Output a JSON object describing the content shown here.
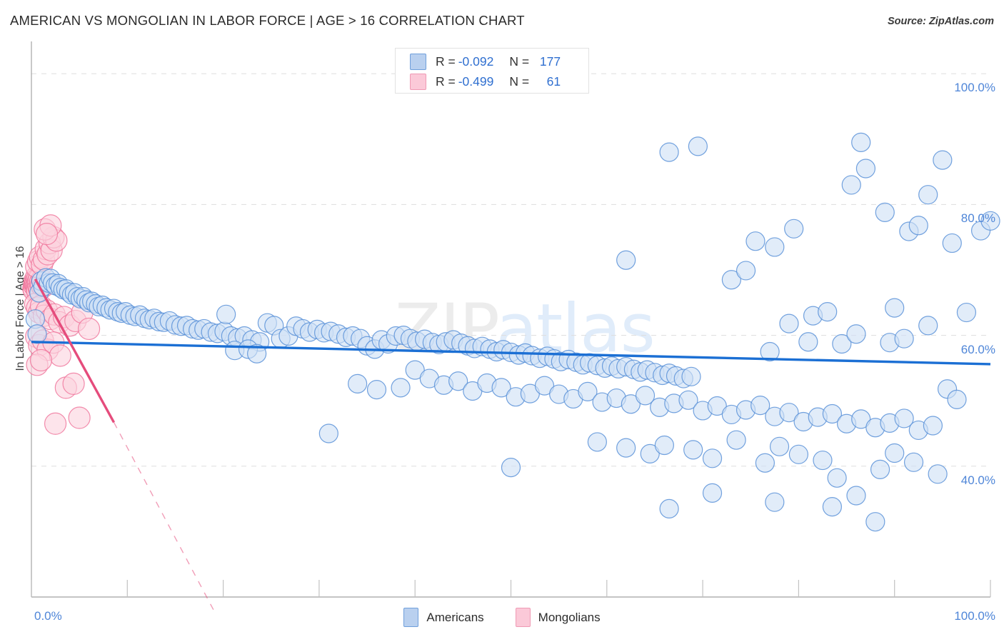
{
  "header": {
    "title": "AMERICAN VS MONGOLIAN IN LABOR FORCE | AGE > 16 CORRELATION CHART",
    "source": "Source: ZipAtlas.com"
  },
  "watermark": {
    "part1": "ZIP",
    "part2": "atlas"
  },
  "stats_legend": {
    "rows": [
      {
        "series": "Americans",
        "color": "#b9d0ef",
        "r_label": "R =",
        "r_value": "-0.092",
        "n_label": "N =",
        "n_value": "177"
      },
      {
        "series": "Mongolians",
        "color": "#fbc9d8",
        "r_label": "R =",
        "r_value": "-0.499",
        "n_label": "N =",
        "n_value": "61"
      }
    ]
  },
  "bottom_legend": {
    "items": [
      {
        "label": "Americans",
        "color": "#b9d0ef"
      },
      {
        "label": "Mongolians",
        "color": "#fbc9d8"
      }
    ]
  },
  "chart_data": {
    "type": "scatter",
    "title": "AMERICAN VS MONGOLIAN IN LABOR FORCE | AGE > 16 CORRELATION CHART",
    "xlabel": "",
    "ylabel": "In Labor Force | Age > 16",
    "xlim": [
      0,
      100
    ],
    "ylim": [
      20,
      104.5
    ],
    "grid": true,
    "x_tick_labels": [
      "0.0%",
      "100.0%"
    ],
    "y_tick_labels": [
      "100.0%",
      "80.0%",
      "60.0%",
      "40.0%"
    ],
    "y_tick_values": [
      100,
      80,
      60,
      40
    ],
    "x_minor_ticks": [
      0,
      10,
      20,
      30,
      40,
      50,
      60,
      70,
      80,
      90,
      100
    ],
    "legend_position": "bottom-center",
    "colors": {
      "americans_fill": "#cfe0f5",
      "americans_stroke": "#5b92d8",
      "mongolians_fill": "#fbd3de",
      "mongolians_stroke": "#f0789e",
      "americans_trend": "#1b6fd4",
      "mongolians_trend": "#e8days",
      "mongolians_trend_color": "#e54c7c",
      "axis_text": "#4f86d8",
      "gridline": "#dddddd"
    },
    "series": [
      {
        "name": "Americans",
        "r": -0.092,
        "n": 177,
        "marker_fill": "#cfe0f5",
        "marker_stroke": "#5b92d8",
        "trendline": {
          "color": "#1b6fd4",
          "x0": 0,
          "y0": 59.0,
          "x1": 100,
          "y1": 55.6
        },
        "points": [
          [
            0.4,
            62.5
          ],
          [
            0.6,
            60.2
          ],
          [
            0.8,
            66.5
          ],
          [
            1.0,
            68.3
          ],
          [
            1.2,
            67.4
          ],
          [
            1.5,
            68.8
          ],
          [
            1.8,
            68.0
          ],
          [
            2.0,
            68.7
          ],
          [
            2.2,
            68.0
          ],
          [
            2.5,
            67.6
          ],
          [
            2.8,
            67.9
          ],
          [
            3.0,
            67.3
          ],
          [
            3.3,
            67.0
          ],
          [
            3.6,
            67.1
          ],
          [
            3.9,
            66.6
          ],
          [
            4.2,
            66.2
          ],
          [
            4.5,
            66.5
          ],
          [
            4.8,
            65.9
          ],
          [
            5.1,
            65.6
          ],
          [
            5.4,
            65.9
          ],
          [
            5.7,
            65.4
          ],
          [
            6.0,
            65.0
          ],
          [
            6.3,
            65.2
          ],
          [
            6.7,
            64.8
          ],
          [
            7.0,
            64.4
          ],
          [
            7.4,
            64.6
          ],
          [
            7.8,
            64.2
          ],
          [
            8.2,
            63.9
          ],
          [
            8.6,
            64.1
          ],
          [
            9.0,
            63.6
          ],
          [
            9.4,
            63.4
          ],
          [
            9.8,
            63.6
          ],
          [
            10.3,
            63.1
          ],
          [
            10.8,
            62.9
          ],
          [
            11.3,
            63.1
          ],
          [
            11.8,
            62.6
          ],
          [
            12.3,
            62.4
          ],
          [
            12.8,
            62.6
          ],
          [
            13.3,
            62.1
          ],
          [
            13.8,
            62.0
          ],
          [
            14.4,
            62.2
          ],
          [
            15.0,
            61.6
          ],
          [
            15.6,
            61.4
          ],
          [
            16.2,
            61.5
          ],
          [
            16.8,
            61.0
          ],
          [
            17.4,
            60.8
          ],
          [
            18.0,
            61.0
          ],
          [
            18.7,
            60.5
          ],
          [
            19.4,
            60.3
          ],
          [
            20.1,
            60.6
          ],
          [
            20.3,
            63.2
          ],
          [
            20.8,
            59.9
          ],
          [
            21.5,
            59.6
          ],
          [
            22.2,
            59.9
          ],
          [
            23.0,
            59.3
          ],
          [
            23.8,
            59.0
          ],
          [
            21.2,
            57.7
          ],
          [
            22.6,
            57.9
          ],
          [
            24.6,
            61.9
          ],
          [
            25.3,
            61.5
          ],
          [
            26.0,
            59.5
          ],
          [
            26.8,
            59.9
          ],
          [
            27.6,
            61.4
          ],
          [
            28.3,
            61.0
          ],
          [
            29.0,
            60.5
          ],
          [
            29.8,
            60.9
          ],
          [
            30.5,
            60.4
          ],
          [
            31.2,
            60.6
          ],
          [
            32.0,
            60.2
          ],
          [
            32.8,
            59.7
          ],
          [
            33.5,
            59.9
          ],
          [
            34.3,
            59.5
          ],
          [
            35.0,
            58.4
          ],
          [
            35.8,
            57.9
          ],
          [
            36.5,
            59.3
          ],
          [
            37.2,
            58.7
          ],
          [
            23.5,
            57.2
          ],
          [
            38.0,
            59.9
          ],
          [
            38.8,
            60.0
          ],
          [
            39.5,
            59.5
          ],
          [
            40.2,
            59.1
          ],
          [
            41.0,
            59.4
          ],
          [
            41.8,
            58.9
          ],
          [
            42.5,
            58.6
          ],
          [
            43.2,
            59.0
          ],
          [
            44.0,
            59.3
          ],
          [
            44.8,
            58.8
          ],
          [
            45.5,
            58.4
          ],
          [
            46.2,
            58.0
          ],
          [
            47.0,
            58.3
          ],
          [
            47.8,
            57.9
          ],
          [
            48.5,
            57.5
          ],
          [
            49.2,
            57.8
          ],
          [
            50.0,
            57.4
          ],
          [
            50.8,
            57.0
          ],
          [
            51.5,
            57.3
          ],
          [
            52.2,
            56.9
          ],
          [
            53.0,
            56.5
          ],
          [
            53.8,
            56.8
          ],
          [
            54.5,
            56.4
          ],
          [
            55.2,
            56.0
          ],
          [
            56.0,
            56.3
          ],
          [
            56.8,
            55.9
          ],
          [
            57.5,
            55.5
          ],
          [
            58.2,
            55.8
          ],
          [
            59.0,
            55.4
          ],
          [
            59.8,
            55.0
          ],
          [
            60.5,
            55.3
          ],
          [
            61.2,
            54.9
          ],
          [
            62.0,
            55.2
          ],
          [
            62.8,
            54.8
          ],
          [
            63.5,
            54.4
          ],
          [
            64.2,
            54.7
          ],
          [
            65.0,
            54.3
          ],
          [
            65.8,
            53.9
          ],
          [
            66.5,
            54.2
          ],
          [
            67.2,
            53.8
          ],
          [
            68.0,
            53.4
          ],
          [
            68.8,
            53.7
          ],
          [
            34.0,
            52.6
          ],
          [
            36.0,
            51.7
          ],
          [
            38.5,
            52.0
          ],
          [
            40.0,
            54.7
          ],
          [
            41.5,
            53.4
          ],
          [
            43.0,
            52.4
          ],
          [
            44.5,
            53.0
          ],
          [
            46.0,
            51.5
          ],
          [
            47.5,
            52.7
          ],
          [
            49.0,
            52.0
          ],
          [
            50.5,
            50.6
          ],
          [
            52.0,
            51.1
          ],
          [
            53.5,
            52.3
          ],
          [
            55.0,
            51.0
          ],
          [
            56.5,
            50.3
          ],
          [
            58.0,
            51.4
          ],
          [
            59.5,
            49.8
          ],
          [
            61.0,
            50.4
          ],
          [
            62.5,
            49.5
          ],
          [
            64.0,
            50.8
          ],
          [
            65.5,
            49.0
          ],
          [
            67.0,
            49.6
          ],
          [
            68.5,
            50.1
          ],
          [
            70.0,
            48.5
          ],
          [
            71.5,
            49.2
          ],
          [
            73.0,
            47.9
          ],
          [
            74.5,
            48.6
          ],
          [
            76.0,
            49.3
          ],
          [
            77.5,
            47.6
          ],
          [
            79.0,
            48.2
          ],
          [
            80.5,
            46.8
          ],
          [
            82.0,
            47.5
          ],
          [
            83.5,
            48.0
          ],
          [
            85.0,
            46.5
          ],
          [
            86.5,
            47.2
          ],
          [
            88.0,
            45.9
          ],
          [
            89.5,
            46.6
          ],
          [
            91.0,
            47.3
          ],
          [
            92.5,
            45.5
          ],
          [
            94.0,
            46.2
          ],
          [
            31.0,
            45.0
          ],
          [
            59.0,
            43.7
          ],
          [
            62.0,
            42.8
          ],
          [
            64.5,
            41.9
          ],
          [
            66.0,
            43.2
          ],
          [
            69.0,
            42.5
          ],
          [
            71.0,
            41.2
          ],
          [
            73.5,
            44.0
          ],
          [
            76.5,
            40.5
          ],
          [
            78.0,
            43.0
          ],
          [
            80.0,
            41.8
          ],
          [
            82.5,
            40.9
          ],
          [
            84.0,
            38.2
          ],
          [
            86.0,
            35.5
          ],
          [
            88.5,
            39.5
          ],
          [
            90.0,
            42.0
          ],
          [
            92.0,
            40.6
          ],
          [
            94.5,
            38.8
          ],
          [
            66.5,
            33.5
          ],
          [
            71.0,
            35.9
          ],
          [
            77.5,
            34.5
          ],
          [
            83.5,
            33.8
          ],
          [
            88.0,
            31.5
          ],
          [
            62.0,
            71.5
          ],
          [
            66.5,
            88.0
          ],
          [
            69.5,
            88.9
          ],
          [
            73.0,
            68.5
          ],
          [
            74.5,
            69.9
          ],
          [
            75.5,
            74.4
          ],
          [
            77.5,
            73.5
          ],
          [
            79.5,
            76.3
          ],
          [
            81.5,
            63.0
          ],
          [
            83.0,
            63.6
          ],
          [
            85.5,
            83.0
          ],
          [
            86.5,
            89.5
          ],
          [
            87.0,
            85.5
          ],
          [
            89.0,
            78.8
          ],
          [
            90.0,
            64.2
          ],
          [
            91.5,
            75.9
          ],
          [
            92.5,
            76.8
          ],
          [
            93.5,
            81.5
          ],
          [
            95.0,
            86.8
          ],
          [
            96.0,
            74.1
          ],
          [
            97.5,
            63.5
          ],
          [
            99.0,
            76.0
          ],
          [
            100.0,
            77.5
          ],
          [
            77.0,
            57.5
          ],
          [
            79.0,
            61.8
          ],
          [
            81.0,
            59.0
          ],
          [
            84.5,
            58.7
          ],
          [
            86.0,
            60.2
          ],
          [
            89.5,
            58.9
          ],
          [
            91.0,
            59.5
          ],
          [
            93.5,
            61.5
          ],
          [
            95.5,
            51.8
          ],
          [
            96.5,
            50.2
          ],
          [
            50.0,
            39.8
          ]
        ]
      },
      {
        "name": "Mongolians",
        "r": -0.499,
        "n": 61,
        "marker_fill": "#fbd3de",
        "marker_stroke": "#f0789e",
        "trendline": {
          "color": "#e54c7c",
          "x0": 0.4,
          "y0": 68.6,
          "x1": 8.6,
          "y1": 46.7,
          "dash_x1": 19.0,
          "dash_y1": 18.0
        },
        "points": [
          [
            0.2,
            67.2
          ],
          [
            0.25,
            66.9
          ],
          [
            0.3,
            67.6
          ],
          [
            0.3,
            68.0
          ],
          [
            0.35,
            68.4
          ],
          [
            0.4,
            67.8
          ],
          [
            0.45,
            68.2
          ],
          [
            0.5,
            67.5
          ],
          [
            0.5,
            68.9
          ],
          [
            0.55,
            67.1
          ],
          [
            0.6,
            68.6
          ],
          [
            0.6,
            66.8
          ],
          [
            0.65,
            67.9
          ],
          [
            0.7,
            68.3
          ],
          [
            0.75,
            67.3
          ],
          [
            0.8,
            68.7
          ],
          [
            0.85,
            67.0
          ],
          [
            0.9,
            68.1
          ],
          [
            1.0,
            67.7
          ],
          [
            1.1,
            68.5
          ],
          [
            1.2,
            67.4
          ],
          [
            0.5,
            70.5
          ],
          [
            0.7,
            71.3
          ],
          [
            0.9,
            72.0
          ],
          [
            1.1,
            70.8
          ],
          [
            1.3,
            71.6
          ],
          [
            1.5,
            73.2
          ],
          [
            1.7,
            72.4
          ],
          [
            1.9,
            74.1
          ],
          [
            2.1,
            73.0
          ],
          [
            2.3,
            75.0
          ],
          [
            2.6,
            74.5
          ],
          [
            1.4,
            76.2
          ],
          [
            2.0,
            76.8
          ],
          [
            1.6,
            75.5
          ],
          [
            0.4,
            64.8
          ],
          [
            0.6,
            64.2
          ],
          [
            0.8,
            63.5
          ],
          [
            1.0,
            64.5
          ],
          [
            1.3,
            63.0
          ],
          [
            1.6,
            63.8
          ],
          [
            2.0,
            62.5
          ],
          [
            2.4,
            63.2
          ],
          [
            2.9,
            62.0
          ],
          [
            3.4,
            62.8
          ],
          [
            4.0,
            61.5
          ],
          [
            4.6,
            62.2
          ],
          [
            5.3,
            63.5
          ],
          [
            6.0,
            61.0
          ],
          [
            0.5,
            59.8
          ],
          [
            0.8,
            58.5
          ],
          [
            1.2,
            59.2
          ],
          [
            1.7,
            57.8
          ],
          [
            2.3,
            58.9
          ],
          [
            3.0,
            56.9
          ],
          [
            0.6,
            55.5
          ],
          [
            1.0,
            56.2
          ],
          [
            3.6,
            52.0
          ],
          [
            4.4,
            52.6
          ],
          [
            2.5,
            46.5
          ],
          [
            5.0,
            47.4
          ]
        ]
      }
    ]
  }
}
